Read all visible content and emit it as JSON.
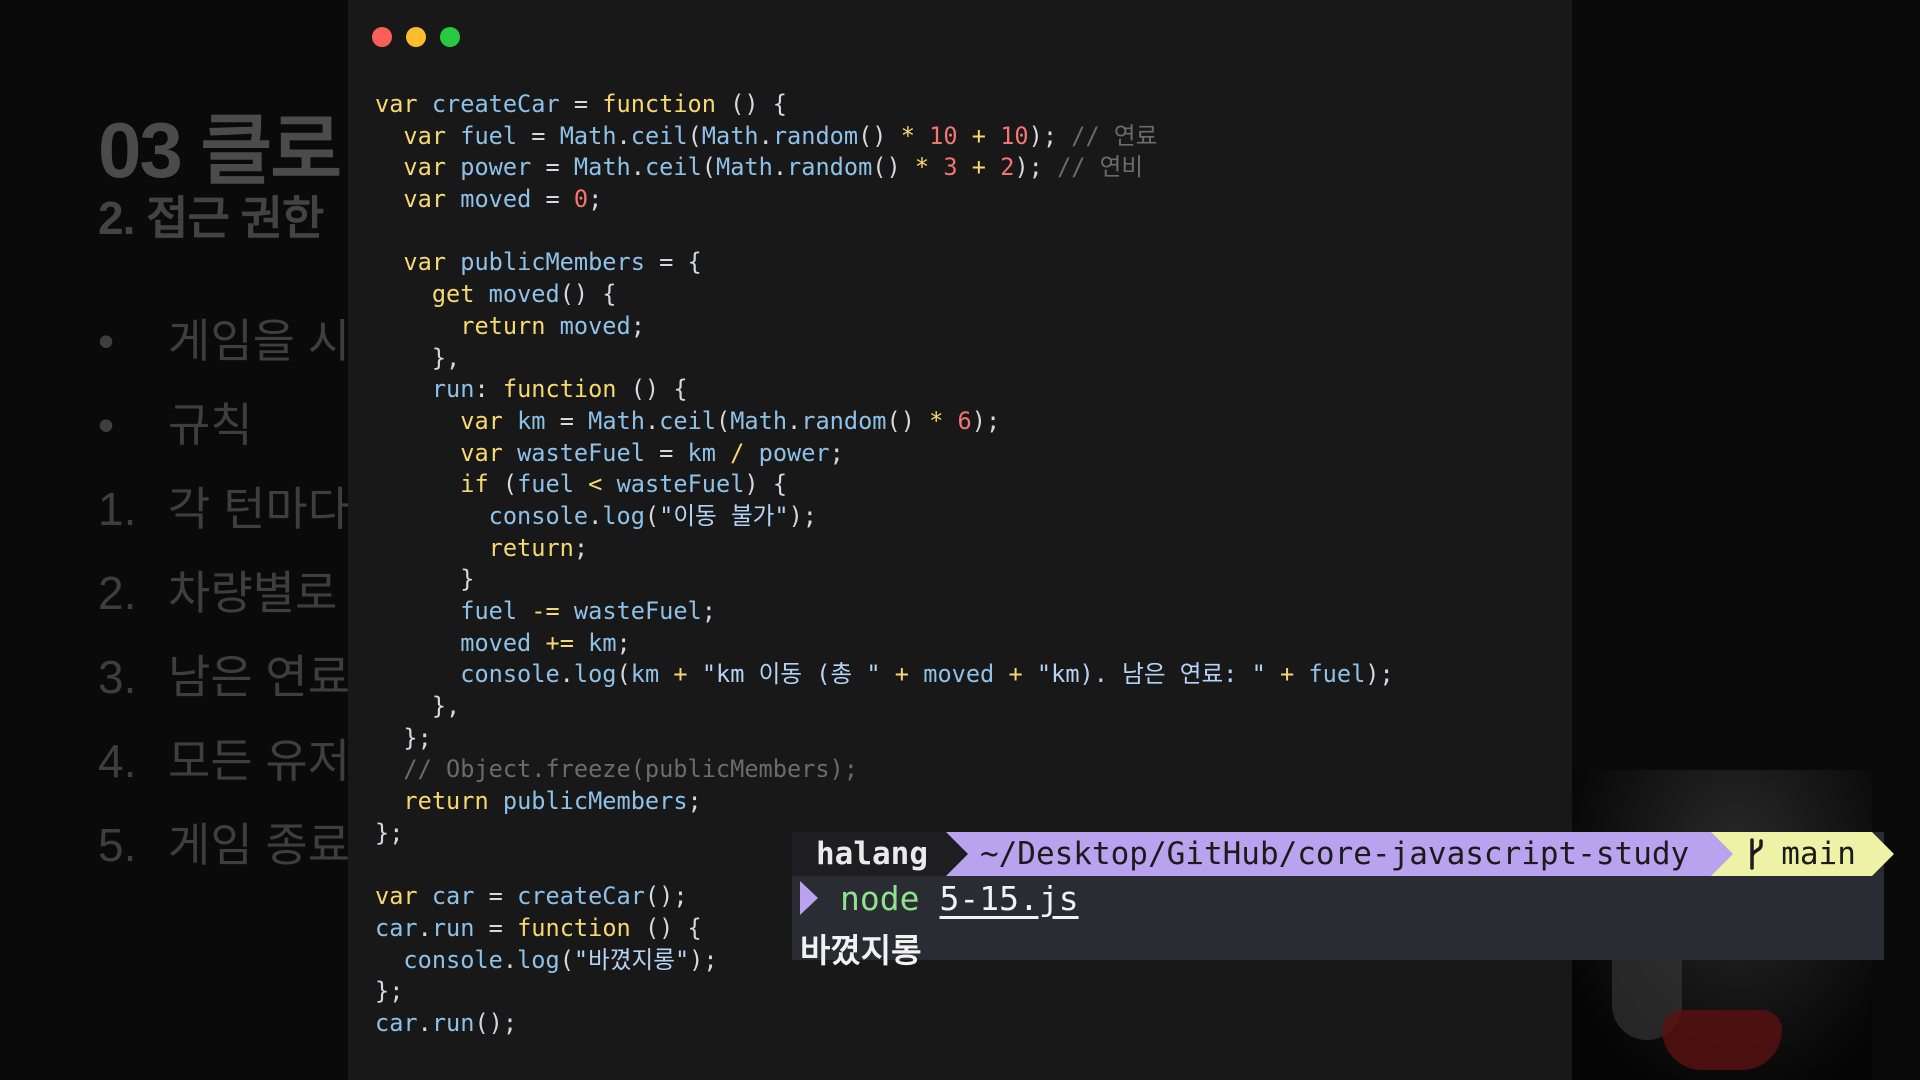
{
  "slide": {
    "title": "03 클로",
    "subtitle": "2. 접근 권한",
    "items": [
      {
        "marker": "•",
        "text": "게임을 시작"
      },
      {
        "marker": "•",
        "text": "규칙"
      },
      {
        "marker": "1.",
        "text": "각 턴마다"
      },
      {
        "marker": "2.",
        "text": "차량별로"
      },
      {
        "marker": "3.",
        "text": "남은 연료"
      },
      {
        "marker": "4.",
        "text": "모든 유저"
      },
      {
        "marker": "5.",
        "text": "게임 종료"
      }
    ]
  },
  "editor": {
    "window_controls": [
      "close",
      "minimize",
      "zoom"
    ],
    "syntax_colors": {
      "keyword": "#f6d86f",
      "identifier": "#8ec1e8",
      "number": "#f47373",
      "string": "#b5d3f7",
      "comment": "#6b6b6b",
      "plain": "#d6d8de"
    },
    "lines": [
      [
        [
          "kw",
          "var "
        ],
        [
          "id",
          "createCar"
        ],
        [
          "pl",
          " = "
        ],
        [
          "kw",
          "function"
        ],
        [
          "pl",
          " () {"
        ]
      ],
      [
        [
          "pl",
          "  "
        ],
        [
          "kw",
          "var "
        ],
        [
          "id",
          "fuel"
        ],
        [
          "pl",
          " = "
        ],
        [
          "id",
          "Math"
        ],
        [
          "pl",
          "."
        ],
        [
          "id",
          "ceil"
        ],
        [
          "pl",
          "("
        ],
        [
          "id",
          "Math"
        ],
        [
          "pl",
          "."
        ],
        [
          "id",
          "random"
        ],
        [
          "pl",
          "() "
        ],
        [
          "kw",
          "*"
        ],
        [
          "pl",
          " "
        ],
        [
          "num",
          "10"
        ],
        [
          "pl",
          " "
        ],
        [
          "kw",
          "+"
        ],
        [
          "pl",
          " "
        ],
        [
          "num",
          "10"
        ],
        [
          "pl",
          "); "
        ],
        [
          "cm",
          "// 연료"
        ]
      ],
      [
        [
          "pl",
          "  "
        ],
        [
          "kw",
          "var "
        ],
        [
          "id",
          "power"
        ],
        [
          "pl",
          " = "
        ],
        [
          "id",
          "Math"
        ],
        [
          "pl",
          "."
        ],
        [
          "id",
          "ceil"
        ],
        [
          "pl",
          "("
        ],
        [
          "id",
          "Math"
        ],
        [
          "pl",
          "."
        ],
        [
          "id",
          "random"
        ],
        [
          "pl",
          "() "
        ],
        [
          "kw",
          "*"
        ],
        [
          "pl",
          " "
        ],
        [
          "num",
          "3"
        ],
        [
          "pl",
          " "
        ],
        [
          "kw",
          "+"
        ],
        [
          "pl",
          " "
        ],
        [
          "num",
          "2"
        ],
        [
          "pl",
          "); "
        ],
        [
          "cm",
          "// 연비"
        ]
      ],
      [
        [
          "pl",
          "  "
        ],
        [
          "kw",
          "var "
        ],
        [
          "id",
          "moved"
        ],
        [
          "pl",
          " = "
        ],
        [
          "num",
          "0"
        ],
        [
          "pl",
          ";"
        ]
      ],
      [],
      [
        [
          "pl",
          "  "
        ],
        [
          "kw",
          "var "
        ],
        [
          "id",
          "publicMembers"
        ],
        [
          "pl",
          " = {"
        ]
      ],
      [
        [
          "pl",
          "    "
        ],
        [
          "kw",
          "get "
        ],
        [
          "id",
          "moved"
        ],
        [
          "pl",
          "() {"
        ]
      ],
      [
        [
          "pl",
          "      "
        ],
        [
          "kw",
          "return "
        ],
        [
          "id",
          "moved"
        ],
        [
          "pl",
          ";"
        ]
      ],
      [
        [
          "pl",
          "    },"
        ]
      ],
      [
        [
          "pl",
          "    "
        ],
        [
          "id",
          "run"
        ],
        [
          "pl",
          ": "
        ],
        [
          "kw",
          "function"
        ],
        [
          "pl",
          " () {"
        ]
      ],
      [
        [
          "pl",
          "      "
        ],
        [
          "kw",
          "var "
        ],
        [
          "id",
          "km"
        ],
        [
          "pl",
          " = "
        ],
        [
          "id",
          "Math"
        ],
        [
          "pl",
          "."
        ],
        [
          "id",
          "ceil"
        ],
        [
          "pl",
          "("
        ],
        [
          "id",
          "Math"
        ],
        [
          "pl",
          "."
        ],
        [
          "id",
          "random"
        ],
        [
          "pl",
          "() "
        ],
        [
          "kw",
          "*"
        ],
        [
          "pl",
          " "
        ],
        [
          "num",
          "6"
        ],
        [
          "pl",
          ");"
        ]
      ],
      [
        [
          "pl",
          "      "
        ],
        [
          "kw",
          "var "
        ],
        [
          "id",
          "wasteFuel"
        ],
        [
          "pl",
          " = "
        ],
        [
          "id",
          "km"
        ],
        [
          "pl",
          " "
        ],
        [
          "kw",
          "/"
        ],
        [
          "pl",
          " "
        ],
        [
          "id",
          "power"
        ],
        [
          "pl",
          ";"
        ]
      ],
      [
        [
          "pl",
          "      "
        ],
        [
          "kw",
          "if"
        ],
        [
          "pl",
          " ("
        ],
        [
          "id",
          "fuel"
        ],
        [
          "pl",
          " "
        ],
        [
          "kw",
          "<"
        ],
        [
          "pl",
          " "
        ],
        [
          "id",
          "wasteFuel"
        ],
        [
          "pl",
          ") {"
        ]
      ],
      [
        [
          "pl",
          "        "
        ],
        [
          "id",
          "console"
        ],
        [
          "pl",
          "."
        ],
        [
          "id",
          "log"
        ],
        [
          "pl",
          "("
        ],
        [
          "str",
          "\"이동 불가\""
        ],
        [
          "pl",
          ");"
        ]
      ],
      [
        [
          "pl",
          "        "
        ],
        [
          "kw",
          "return"
        ],
        [
          "pl",
          ";"
        ]
      ],
      [
        [
          "pl",
          "      }"
        ]
      ],
      [
        [
          "pl",
          "      "
        ],
        [
          "id",
          "fuel"
        ],
        [
          "pl",
          " "
        ],
        [
          "kw",
          "-="
        ],
        [
          "pl",
          " "
        ],
        [
          "id",
          "wasteFuel"
        ],
        [
          "pl",
          ";"
        ]
      ],
      [
        [
          "pl",
          "      "
        ],
        [
          "id",
          "moved"
        ],
        [
          "pl",
          " "
        ],
        [
          "kw",
          "+="
        ],
        [
          "pl",
          " "
        ],
        [
          "id",
          "km"
        ],
        [
          "pl",
          ";"
        ]
      ],
      [
        [
          "pl",
          "      "
        ],
        [
          "id",
          "console"
        ],
        [
          "pl",
          "."
        ],
        [
          "id",
          "log"
        ],
        [
          "pl",
          "("
        ],
        [
          "id",
          "km"
        ],
        [
          "pl",
          " "
        ],
        [
          "kw",
          "+"
        ],
        [
          "pl",
          " "
        ],
        [
          "str",
          "\"km 이동 (총 \""
        ],
        [
          "pl",
          " "
        ],
        [
          "kw",
          "+"
        ],
        [
          "pl",
          " "
        ],
        [
          "id",
          "moved"
        ],
        [
          "pl",
          " "
        ],
        [
          "kw",
          "+"
        ],
        [
          "pl",
          " "
        ],
        [
          "str",
          "\"km). 남은 연료: \""
        ],
        [
          "pl",
          " "
        ],
        [
          "kw",
          "+"
        ],
        [
          "pl",
          " "
        ],
        [
          "id",
          "fuel"
        ],
        [
          "pl",
          ");"
        ]
      ],
      [
        [
          "pl",
          "    },"
        ]
      ],
      [
        [
          "pl",
          "  };"
        ]
      ],
      [
        [
          "pl",
          "  "
        ],
        [
          "cm",
          "// Object.freeze(publicMembers);"
        ]
      ],
      [
        [
          "pl",
          "  "
        ],
        [
          "kw",
          "return "
        ],
        [
          "id",
          "publicMembers"
        ],
        [
          "pl",
          ";"
        ]
      ],
      [
        [
          "pl",
          "};"
        ]
      ],
      [],
      [
        [
          "kw",
          "var "
        ],
        [
          "id",
          "car"
        ],
        [
          "pl",
          " = "
        ],
        [
          "id",
          "createCar"
        ],
        [
          "pl",
          "();"
        ]
      ],
      [
        [
          "id",
          "car"
        ],
        [
          "pl",
          "."
        ],
        [
          "id",
          "run"
        ],
        [
          "pl",
          " = "
        ],
        [
          "kw",
          "function"
        ],
        [
          "pl",
          " () {"
        ]
      ],
      [
        [
          "pl",
          "  "
        ],
        [
          "id",
          "console"
        ],
        [
          "pl",
          "."
        ],
        [
          "id",
          "log"
        ],
        [
          "pl",
          "("
        ],
        [
          "str",
          "\"바꼈지롱\""
        ],
        [
          "pl",
          ");"
        ]
      ],
      [
        [
          "pl",
          "};"
        ]
      ],
      [
        [
          "id",
          "car"
        ],
        [
          "pl",
          "."
        ],
        [
          "id",
          "run"
        ],
        [
          "pl",
          "();"
        ]
      ]
    ]
  },
  "terminal": {
    "user": "halang",
    "path": "~/Desktop/GitHub/core-javascript-study",
    "branch": "main",
    "command": "node",
    "argument": "5-15.js",
    "output": "바꼈지롱"
  }
}
